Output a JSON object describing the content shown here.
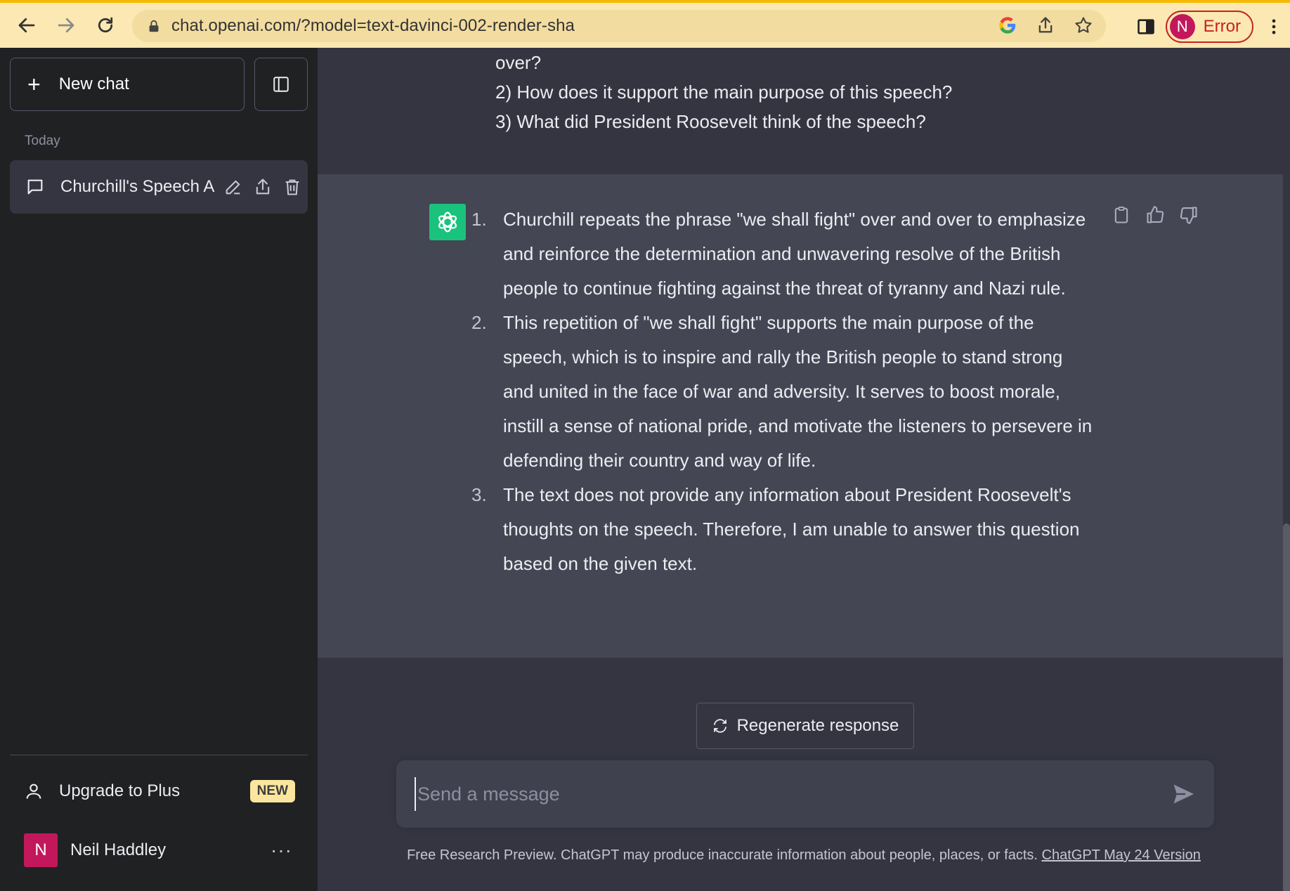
{
  "browser": {
    "url": "chat.openai.com/?model=text-davinci-002-render-sha",
    "profile_initial": "N",
    "profile_status": "Error"
  },
  "sidebar": {
    "new_chat_label": "New chat",
    "section_label": "Today",
    "chats": [
      {
        "title": "Churchill's Speech A"
      }
    ],
    "upgrade_label": "Upgrade to Plus",
    "upgrade_badge": "NEW",
    "user": {
      "initial": "N",
      "name": "Neil Haddley",
      "more": "···"
    }
  },
  "conversation": {
    "user_lines": [
      "over?",
      "2) How does it support the main purpose of this speech?",
      "3) What did President Roosevelt think of the speech?"
    ],
    "assistant_answers": [
      {
        "num": "1.",
        "text": "Churchill repeats the phrase \"we shall fight\" over and over to emphasize and reinforce the determination and unwavering resolve of the British people to continue fighting against the threat of tyranny and Nazi rule."
      },
      {
        "num": "2.",
        "text": "This repetition of \"we shall fight\" supports the main purpose of the speech, which is to inspire and rally the British people to stand strong and united in the face of war and adversity. It serves to boost morale, instill a sense of national pride, and motivate the listeners to persevere in defending their country and way of life."
      },
      {
        "num": "3.",
        "text": "The text does not provide any information about President Roosevelt's thoughts on the speech. Therefore, I am unable to answer this question based on the given text."
      }
    ]
  },
  "composer": {
    "regenerate_label": "Regenerate response",
    "placeholder": "Send a message",
    "footer_text": "Free Research Preview. ChatGPT may produce inaccurate information about people, places, or facts.",
    "footer_link": "ChatGPT May 24 Version"
  },
  "colors": {
    "sidebar_bg": "#202123",
    "main_bg": "#343541",
    "assistant_bg": "#444654",
    "gpt_green": "#19c37d",
    "chrome_bar": "#fce8b2",
    "new_badge": "#fae69e",
    "avatar_pink": "#c2185b"
  }
}
